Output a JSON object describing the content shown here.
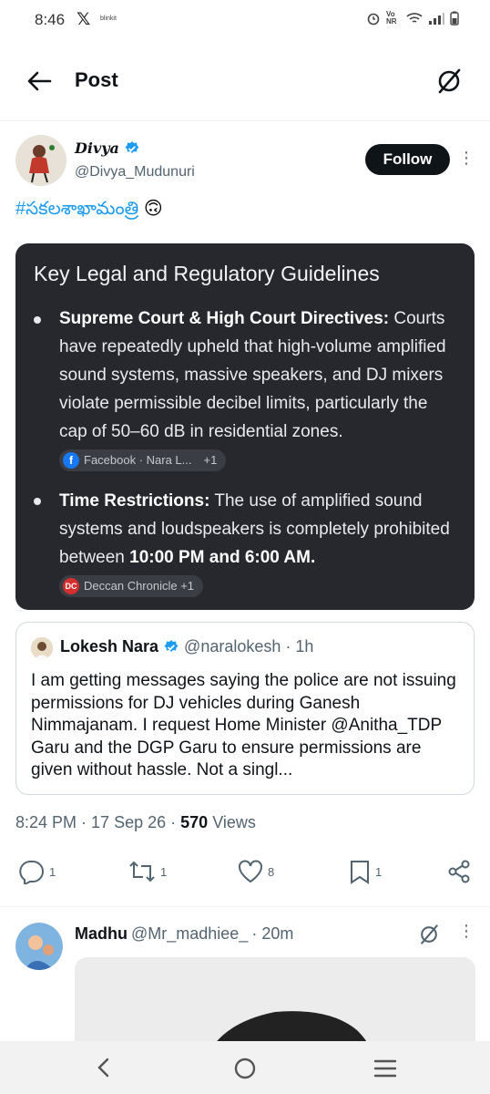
{
  "status_bar": {
    "time": "8:46",
    "x_logo": "𝕏",
    "notification_label": "blinkit",
    "network": "Vo NR"
  },
  "header": {
    "title": "Post"
  },
  "tweet": {
    "author_name": "Divya",
    "author_handle": "@Divya_Mudunuri",
    "follow_label": "Follow",
    "text": "#సకలశాఖామంత్రి",
    "emoji": "🙃",
    "card": {
      "title": "Key Legal and Regulatory Guidelines",
      "item1_heading": "Supreme Court & High Court Directives:",
      "item1_body": " Courts have repeatedly upheld that high-volume amplified sound systems, massive speakers, and DJ mixers violate permissible decibel limits, particularly the cap of 50–60 dB in residential zones.",
      "item1_source": "Facebook · Nara L...",
      "item1_more": "+1",
      "item2_heading": "Time Restrictions:",
      "item2_body": " The use of amplified sound systems and loudspeakers is completely prohibited between ",
      "item2_bold": "10:00 PM and 6:00 AM.",
      "item2_source": "Deccan Chronicle +1"
    },
    "quote": {
      "author_name": "Lokesh Nara",
      "author_handle": "@naralokesh",
      "time": "· 1h",
      "text": "I am getting messages saying the police are not issuing permissions for DJ vehicles during Ganesh Nimmajanam. I request Home Minister @Anitha_TDP Garu and the DGP Garu to ensure permissions are given without hassle. Not a singl..."
    },
    "time": "8:24 PM",
    "date": "17 Sep 26",
    "views_count": "570",
    "views_label": "Views",
    "actions": {
      "replies": "1",
      "reposts": "1",
      "likes": "8",
      "bookmarks": "1"
    }
  },
  "next_post": {
    "author_name": "Madhu",
    "author_handle": "@Mr_madhiee_",
    "time": "· 20m"
  },
  "colors": {
    "accent": "#1d9bf0",
    "card_bg": "#26282d",
    "text": "#0f1419",
    "muted": "#536471"
  }
}
